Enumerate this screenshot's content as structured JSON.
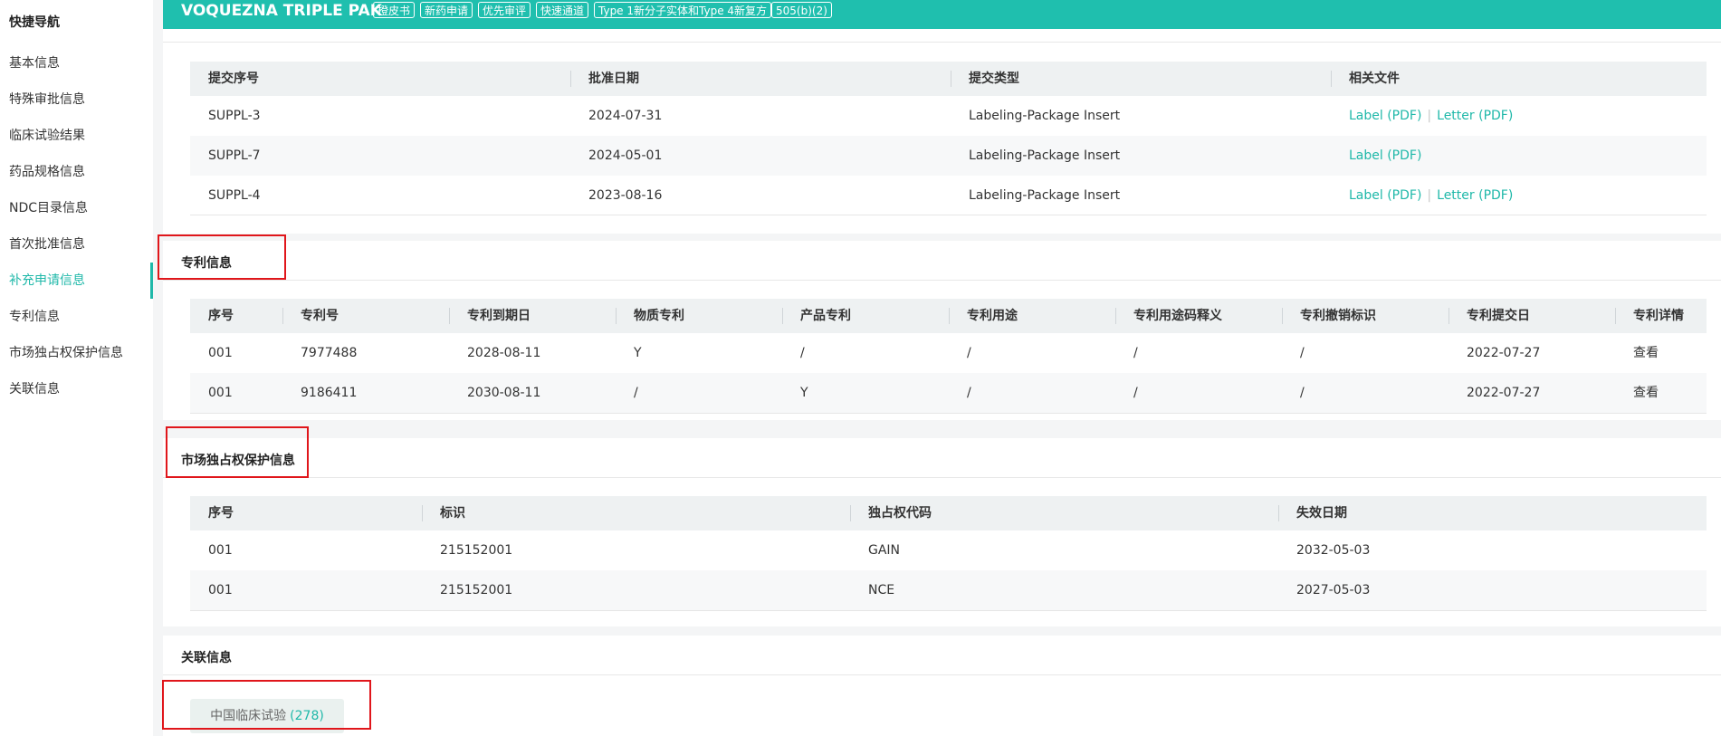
{
  "sidebar": {
    "title": "快捷导航",
    "items": [
      {
        "label": "基本信息"
      },
      {
        "label": "特殊审批信息"
      },
      {
        "label": "临床试验结果"
      },
      {
        "label": "药品规格信息"
      },
      {
        "label": "NDC目录信息"
      },
      {
        "label": "首次批准信息"
      },
      {
        "label": "补充申请信息"
      },
      {
        "label": "专利信息"
      },
      {
        "label": "市场独占权保护信息"
      },
      {
        "label": "关联信息"
      }
    ],
    "active_index": 6
  },
  "header": {
    "title": "VOQUEZNA TRIPLE PAK",
    "tags": [
      "橙皮书",
      "新药申请",
      "优先审评",
      "快速通道",
      "Type 1新分子实体和Type 4新复方",
      "505(b)(2)"
    ]
  },
  "supplements": {
    "columns": [
      "提交序号",
      "批准日期",
      "提交类型",
      "相关文件"
    ],
    "rows": [
      {
        "id": "SUPPL-3",
        "date": "2024-07-31",
        "type": "Labeling-Package Insert",
        "files": [
          "Label (PDF)",
          "Letter (PDF)"
        ]
      },
      {
        "id": "SUPPL-7",
        "date": "2024-05-01",
        "type": "Labeling-Package Insert",
        "files": [
          "Label (PDF)"
        ]
      },
      {
        "id": "SUPPL-4",
        "date": "2023-08-16",
        "type": "Labeling-Package Insert",
        "files": [
          "Label (PDF)",
          "Letter (PDF)"
        ]
      }
    ]
  },
  "patents": {
    "title": "专利信息",
    "columns": [
      "序号",
      "专利号",
      "专利到期日",
      "物质专利",
      "产品专利",
      "专利用途",
      "专利用途码释义",
      "专利撤销标识",
      "专利提交日",
      "专利详情"
    ],
    "rows": [
      [
        "001",
        "7977488",
        "2028-08-11",
        "Y",
        "/",
        "/",
        "/",
        "/",
        "2022-07-27",
        "查看"
      ],
      [
        "001",
        "9186411",
        "2030-08-11",
        "/",
        "Y",
        "/",
        "/",
        "/",
        "2022-07-27",
        "查看"
      ]
    ]
  },
  "exclusivity": {
    "title": "市场独占权保护信息",
    "columns": [
      "序号",
      "标识",
      "独占权代码",
      "失效日期"
    ],
    "rows": [
      [
        "001",
        "215152001",
        "GAIN",
        "2032-05-03"
      ],
      [
        "001",
        "215152001",
        "NCE",
        "2027-05-03"
      ]
    ]
  },
  "related": {
    "title": "关联信息",
    "chip_label": "中国临床试验",
    "chip_count": "(278)"
  },
  "colors": {
    "accent": "#1fbfae",
    "link": "#1fb8a9",
    "highlight_box": "#e0161b"
  }
}
